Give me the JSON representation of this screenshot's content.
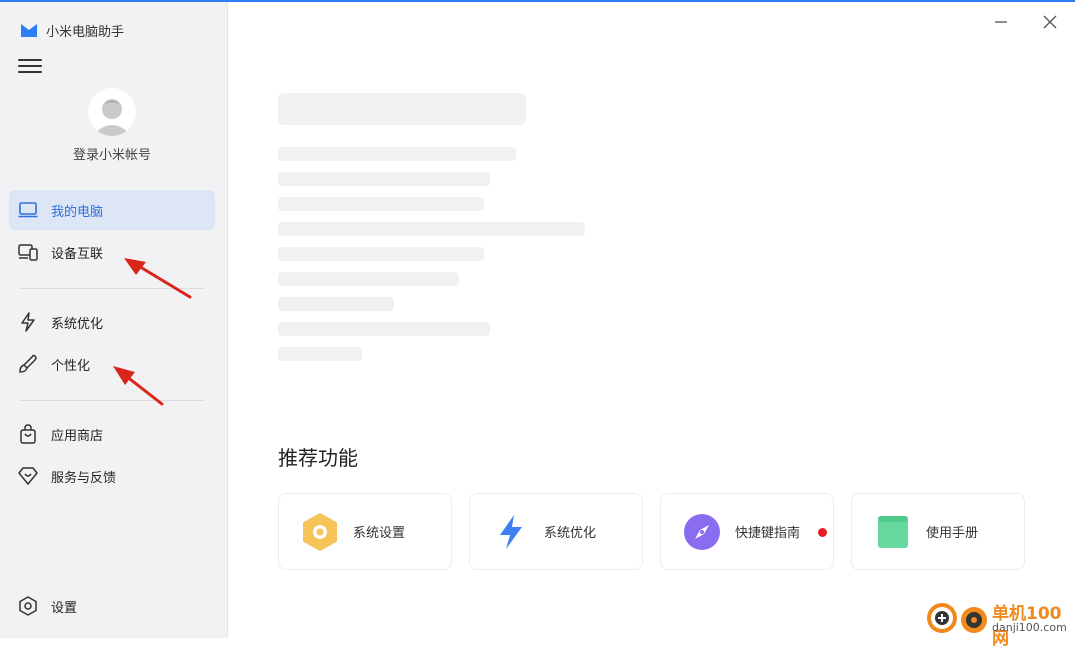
{
  "app": {
    "title": "小米电脑助手"
  },
  "account": {
    "login_label": "登录小米帐号"
  },
  "sidebar": {
    "items": [
      {
        "label": "我的电脑",
        "icon": "laptop-icon",
        "active": true
      },
      {
        "label": "设备互联",
        "icon": "devices-icon"
      },
      {
        "label": "系统优化",
        "icon": "lightning-icon"
      },
      {
        "label": "个性化",
        "icon": "brush-icon"
      },
      {
        "label": "应用商店",
        "icon": "shopping-bag-icon"
      },
      {
        "label": "服务与反馈",
        "icon": "diamond-heart-icon"
      }
    ],
    "settings_label": "设置"
  },
  "main": {
    "section_title": "推荐功能",
    "cards": [
      {
        "label": "系统设置",
        "icon": "hexagon-settings-icon",
        "color": "#f6c55a"
      },
      {
        "label": "系统优化",
        "icon": "lightning-icon",
        "color": "#3e7ff1"
      },
      {
        "label": "快捷键指南",
        "icon": "compass-icon",
        "color": "#8a6cf0",
        "badge": "new-dot"
      },
      {
        "label": "使用手册",
        "icon": "book-icon",
        "color": "#67d9a0"
      }
    ]
  },
  "watermark": {
    "brand": "单机100网",
    "domain": "danji100.com"
  },
  "colors": {
    "accent": "#2f6fd9",
    "active_bg": "#dde6f7",
    "annotation_arrow": "#d9261c"
  }
}
